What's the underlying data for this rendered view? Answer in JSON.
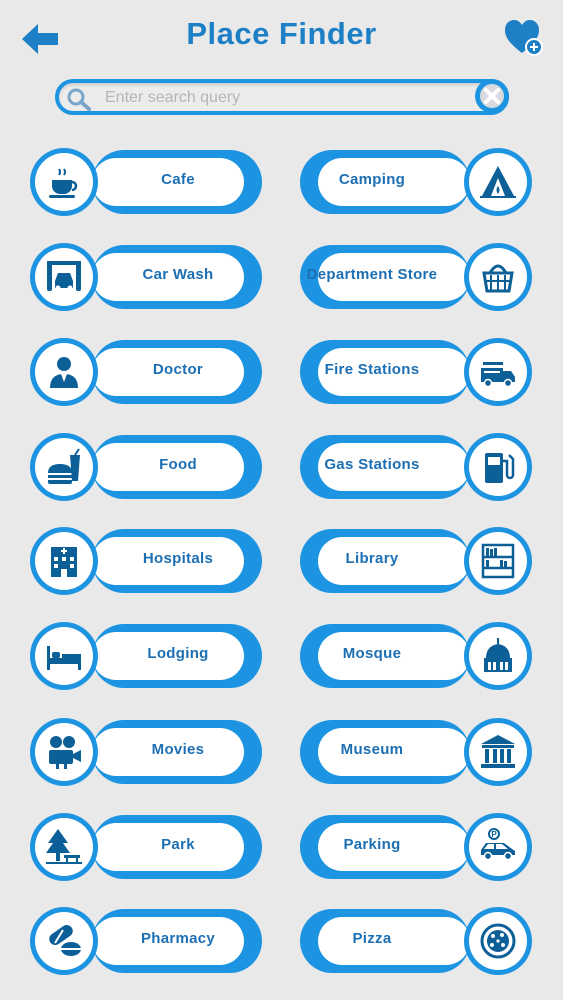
{
  "header": {
    "title": "Place Finder",
    "back_icon": "arrow-left-icon",
    "favorites_icon": "heart-plus-icon"
  },
  "search": {
    "placeholder": "Enter search query",
    "value": "",
    "search_icon": "magnifier-icon",
    "clear_icon": "close-icon"
  },
  "colors": {
    "accent": "#1d94e1",
    "title": "#1d7fc6",
    "icon": "#0d5f98",
    "background": "#e9e9ea"
  },
  "categories": [
    {
      "label": "Cafe",
      "icon": "coffee-cup-icon"
    },
    {
      "label": "Camping",
      "icon": "tent-icon"
    },
    {
      "label": "Car Wash",
      "icon": "car-wash-icon"
    },
    {
      "label": "Department Store",
      "icon": "shopping-basket-icon"
    },
    {
      "label": "Doctor",
      "icon": "doctor-icon"
    },
    {
      "label": "Fire Stations",
      "icon": "fire-truck-icon"
    },
    {
      "label": "Food",
      "icon": "fast-food-icon"
    },
    {
      "label": "Gas Stations",
      "icon": "fuel-pump-icon"
    },
    {
      "label": "Hospitals",
      "icon": "hospital-icon"
    },
    {
      "label": "Library",
      "icon": "bookshelf-icon"
    },
    {
      "label": "Lodging",
      "icon": "bed-icon"
    },
    {
      "label": "Mosque",
      "icon": "mosque-icon"
    },
    {
      "label": "Movies",
      "icon": "movie-projector-icon"
    },
    {
      "label": "Museum",
      "icon": "museum-icon"
    },
    {
      "label": "Park",
      "icon": "tree-bench-icon"
    },
    {
      "label": "Parking",
      "icon": "parking-car-icon"
    },
    {
      "label": "Pharmacy",
      "icon": "pills-icon"
    },
    {
      "label": "Pizza",
      "icon": "pizza-icon"
    }
  ]
}
